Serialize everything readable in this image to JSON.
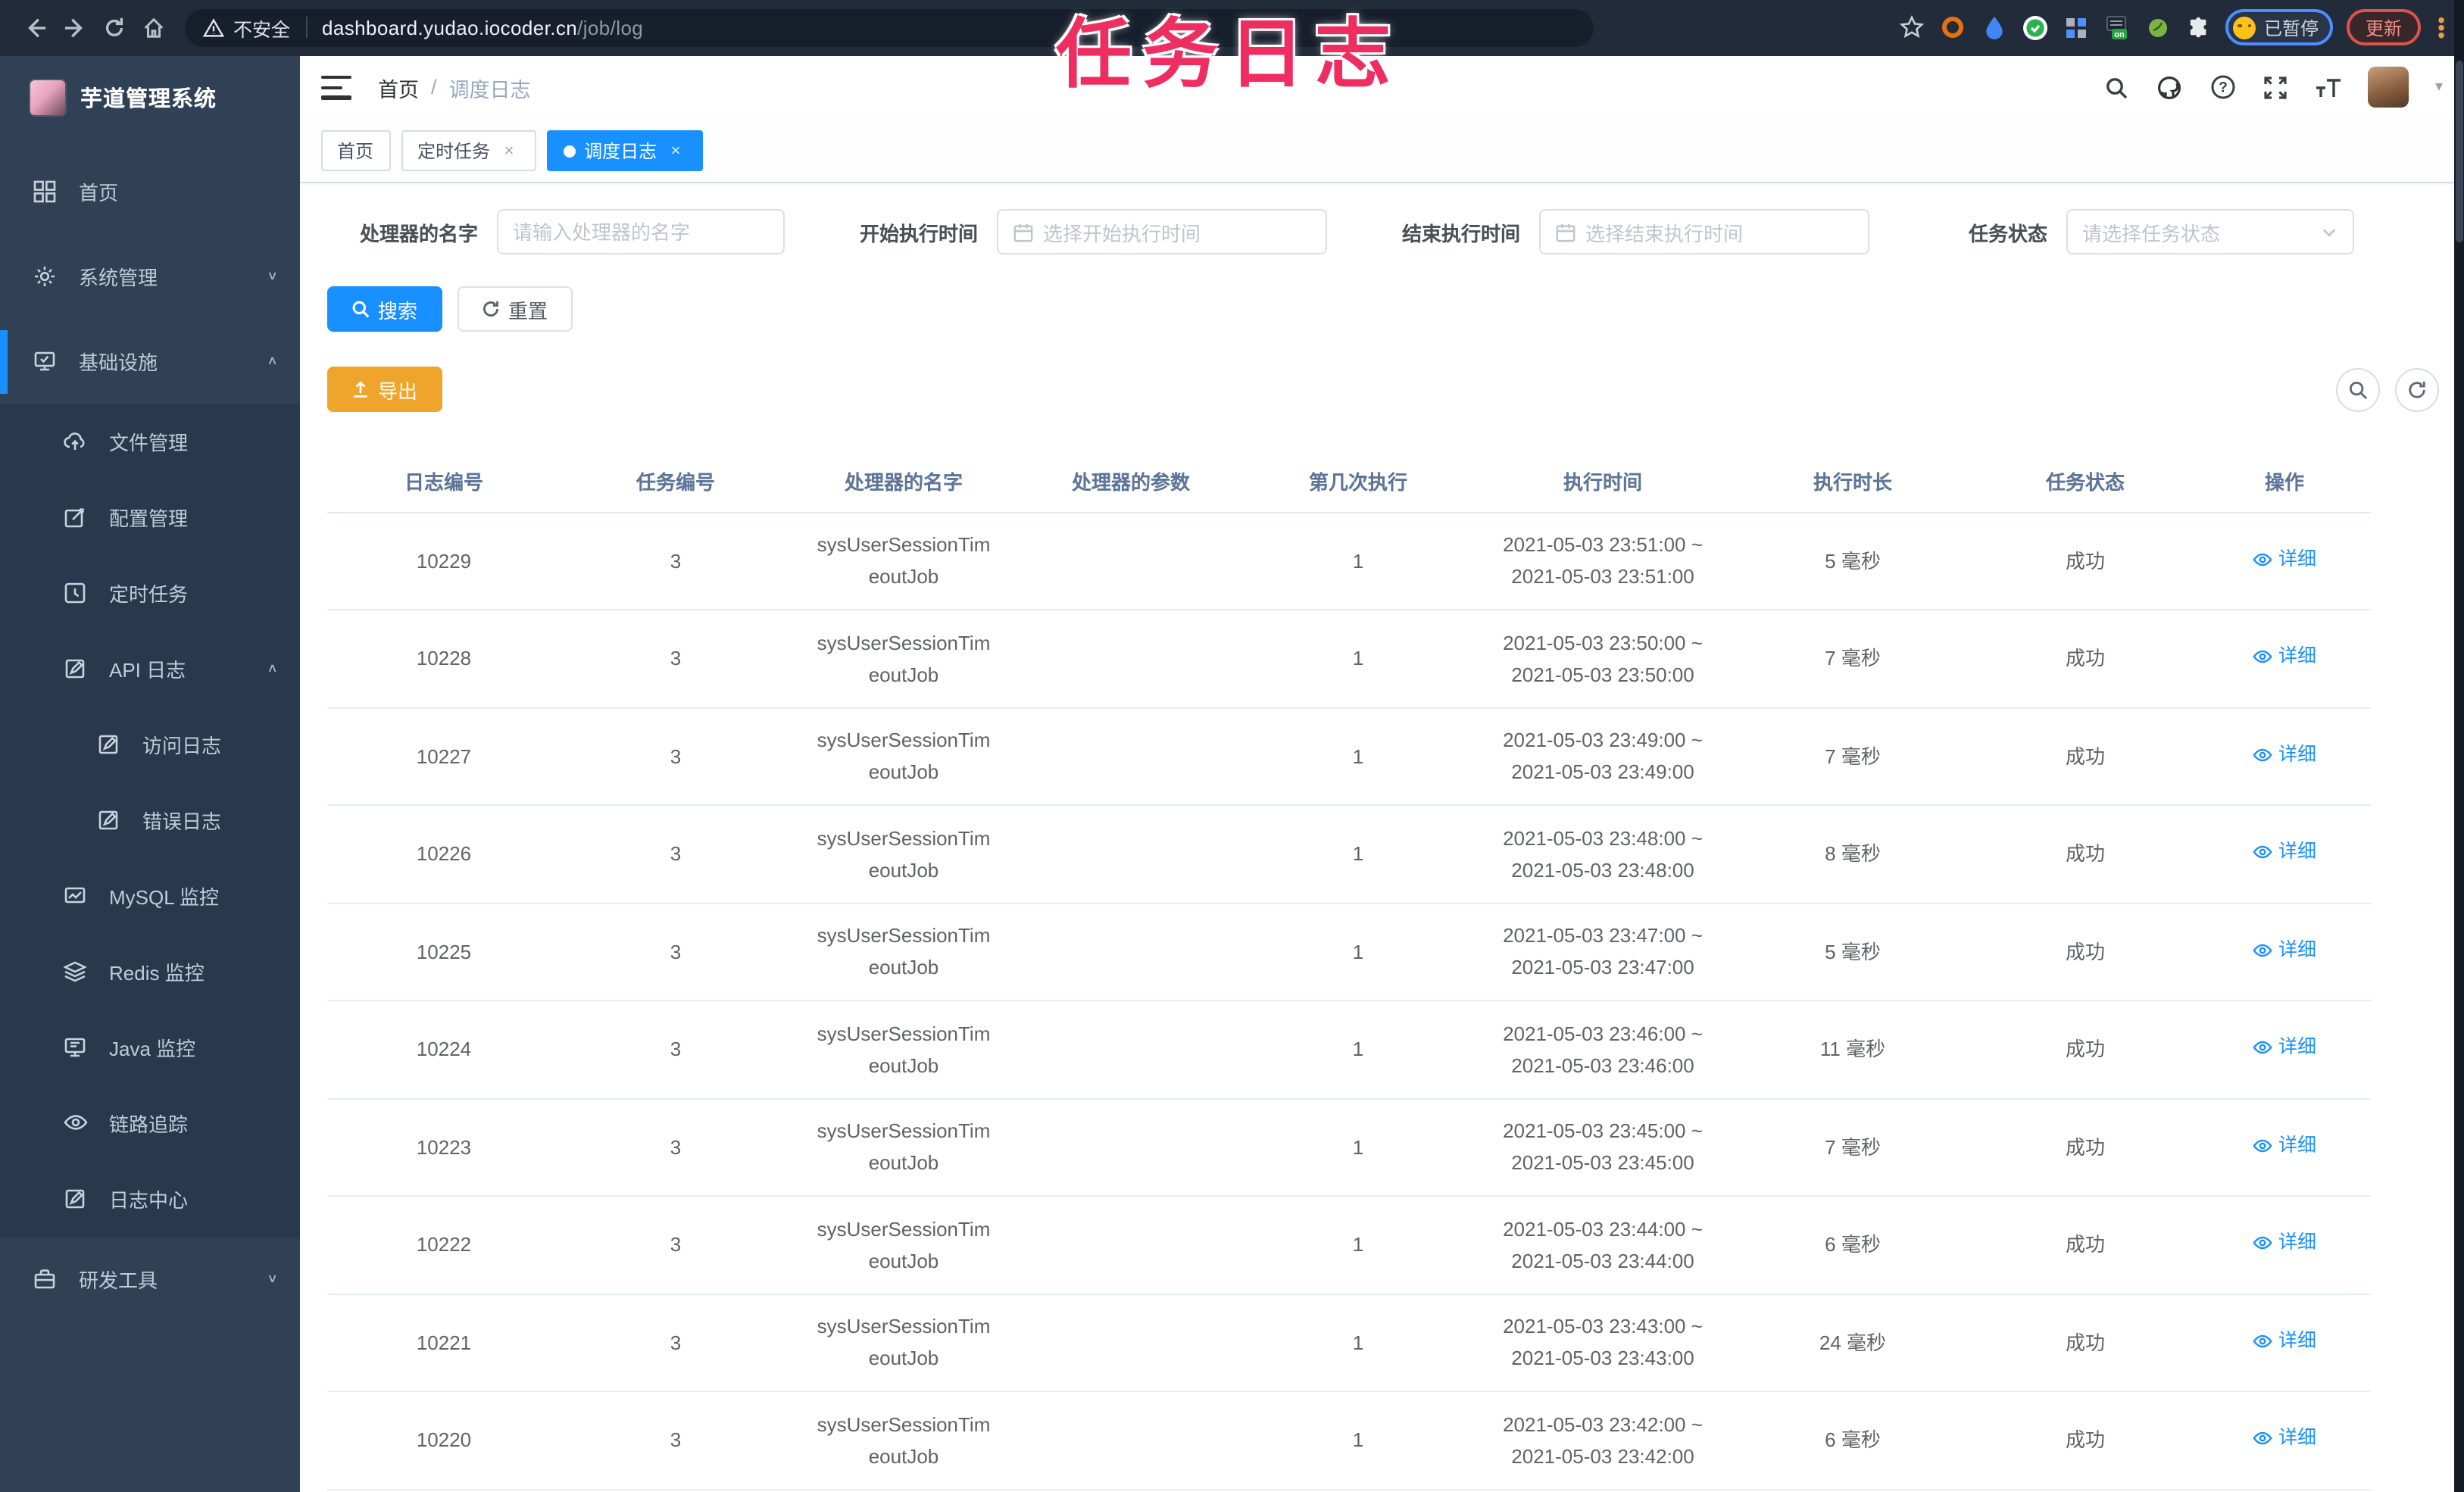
{
  "colors": {
    "accent": "#1890ff",
    "warning": "#efa42c",
    "overlay": "#ee2e61",
    "sidebar_bg": "#304156",
    "submenu_bg": "#28394e",
    "chrome_bg": "#212b3a"
  },
  "browser": {
    "security_label": "不安全",
    "url_host": "dashboard.yudao.iocoder.cn",
    "url_path": "/job/log",
    "profile_badge": "已暂停",
    "update_button": "更新"
  },
  "overlay_title": "任务日志",
  "sidebar": {
    "title": "芋道管理系统",
    "items_top": [
      {
        "label": "首页",
        "icon": "dashboard",
        "arrow": "",
        "state": "",
        "depth": ""
      },
      {
        "label": "系统管理",
        "icon": "gear",
        "arrow": "∨",
        "state": "",
        "depth": ""
      },
      {
        "label": "基础设施",
        "icon": "monitor",
        "arrow": "∧",
        "state": "active",
        "depth": ""
      }
    ],
    "items_sub": [
      {
        "label": "文件管理",
        "icon": "cloud-upload",
        "arrow": "",
        "state": "",
        "depth": "d1"
      },
      {
        "label": "配置管理",
        "icon": "edit-square",
        "arrow": "",
        "state": "",
        "depth": "d1"
      },
      {
        "label": "定时任务",
        "icon": "clock-square",
        "arrow": "",
        "state": "",
        "depth": "d1"
      },
      {
        "label": "API 日志",
        "icon": "doc-edit",
        "arrow": "∧",
        "state": "",
        "depth": "d1"
      },
      {
        "label": "访问日志",
        "icon": "doc-edit",
        "arrow": "",
        "state": "",
        "depth": "d2"
      },
      {
        "label": "错误日志",
        "icon": "doc-edit",
        "arrow": "",
        "state": "",
        "depth": "d2"
      },
      {
        "label": "MySQL 监控",
        "icon": "chart-monitor",
        "arrow": "",
        "state": "",
        "depth": "d1"
      },
      {
        "label": "Redis 监控",
        "icon": "layers",
        "arrow": "",
        "state": "",
        "depth": "d1"
      },
      {
        "label": "Java 监控",
        "icon": "java-monitor",
        "arrow": "",
        "state": "",
        "depth": "d1"
      },
      {
        "label": "链路追踪",
        "icon": "eye",
        "arrow": "",
        "state": "",
        "depth": "d1"
      },
      {
        "label": "日志中心",
        "icon": "doc-edit",
        "arrow": "",
        "state": "",
        "depth": "d1"
      }
    ],
    "items_bottom": [
      {
        "label": "研发工具",
        "icon": "briefcase",
        "arrow": "∨",
        "state": "",
        "depth": ""
      }
    ]
  },
  "header": {
    "breadcrumb_home": "首页",
    "breadcrumb_sep": "/",
    "breadcrumb_current": "调度日志"
  },
  "tabs": {
    "close_glyph": "×",
    "items": [
      {
        "label": "首页"
      },
      {
        "label": "定时任务"
      },
      {
        "label": "调度日志"
      }
    ]
  },
  "filters": {
    "name": {
      "label": "处理器的名字",
      "placeholder": "请输入处理器的名字"
    },
    "start": {
      "label": "开始执行时间",
      "placeholder": "选择开始执行时间"
    },
    "end": {
      "label": "结束执行时间",
      "placeholder": "选择结束执行时间"
    },
    "status": {
      "label": "任务状态",
      "placeholder": "请选择任务状态"
    }
  },
  "actions": {
    "search": "搜索",
    "reset": "重置",
    "export": "导出"
  },
  "table": {
    "headers": [
      "日志编号",
      "任务编号",
      "处理器的名字",
      "处理器的参数",
      "第几次执行",
      "执行时间",
      "执行时长",
      "任务状态",
      "操作"
    ],
    "rows": [
      {
        "log_id": "10229",
        "job_id": "3",
        "handler_line1": "sysUserSessionTim",
        "handler_line2": "eoutJob",
        "param": "",
        "count": "1",
        "time1": "2021-05-03 23:51:00 ~",
        "time2": "2021-05-03 23:51:00",
        "duration": "5 毫秒",
        "status": "成功",
        "action": "详细"
      },
      {
        "log_id": "10228",
        "job_id": "3",
        "handler_line1": "sysUserSessionTim",
        "handler_line2": "eoutJob",
        "param": "",
        "count": "1",
        "time1": "2021-05-03 23:50:00 ~",
        "time2": "2021-05-03 23:50:00",
        "duration": "7 毫秒",
        "status": "成功",
        "action": "详细"
      },
      {
        "log_id": "10227",
        "job_id": "3",
        "handler_line1": "sysUserSessionTim",
        "handler_line2": "eoutJob",
        "param": "",
        "count": "1",
        "time1": "2021-05-03 23:49:00 ~",
        "time2": "2021-05-03 23:49:00",
        "duration": "7 毫秒",
        "status": "成功",
        "action": "详细"
      },
      {
        "log_id": "10226",
        "job_id": "3",
        "handler_line1": "sysUserSessionTim",
        "handler_line2": "eoutJob",
        "param": "",
        "count": "1",
        "time1": "2021-05-03 23:48:00 ~",
        "time2": "2021-05-03 23:48:00",
        "duration": "8 毫秒",
        "status": "成功",
        "action": "详细"
      },
      {
        "log_id": "10225",
        "job_id": "3",
        "handler_line1": "sysUserSessionTim",
        "handler_line2": "eoutJob",
        "param": "",
        "count": "1",
        "time1": "2021-05-03 23:47:00 ~",
        "time2": "2021-05-03 23:47:00",
        "duration": "5 毫秒",
        "status": "成功",
        "action": "详细"
      },
      {
        "log_id": "10224",
        "job_id": "3",
        "handler_line1": "sysUserSessionTim",
        "handler_line2": "eoutJob",
        "param": "",
        "count": "1",
        "time1": "2021-05-03 23:46:00 ~",
        "time2": "2021-05-03 23:46:00",
        "duration": "11 毫秒",
        "status": "成功",
        "action": "详细"
      },
      {
        "log_id": "10223",
        "job_id": "3",
        "handler_line1": "sysUserSessionTim",
        "handler_line2": "eoutJob",
        "param": "",
        "count": "1",
        "time1": "2021-05-03 23:45:00 ~",
        "time2": "2021-05-03 23:45:00",
        "duration": "7 毫秒",
        "status": "成功",
        "action": "详细"
      },
      {
        "log_id": "10222",
        "job_id": "3",
        "handler_line1": "sysUserSessionTim",
        "handler_line2": "eoutJob",
        "param": "",
        "count": "1",
        "time1": "2021-05-03 23:44:00 ~",
        "time2": "2021-05-03 23:44:00",
        "duration": "6 毫秒",
        "status": "成功",
        "action": "详细"
      },
      {
        "log_id": "10221",
        "job_id": "3",
        "handler_line1": "sysUserSessionTim",
        "handler_line2": "eoutJob",
        "param": "",
        "count": "1",
        "time1": "2021-05-03 23:43:00 ~",
        "time2": "2021-05-03 23:43:00",
        "duration": "24 毫秒",
        "status": "成功",
        "action": "详细"
      },
      {
        "log_id": "10220",
        "job_id": "3",
        "handler_line1": "sysUserSessionTim",
        "handler_line2": "eoutJob",
        "param": "",
        "count": "1",
        "time1": "2021-05-03 23:42:00 ~",
        "time2": "2021-05-03 23:42:00",
        "duration": "6 毫秒",
        "status": "成功",
        "action": "详细"
      }
    ]
  }
}
